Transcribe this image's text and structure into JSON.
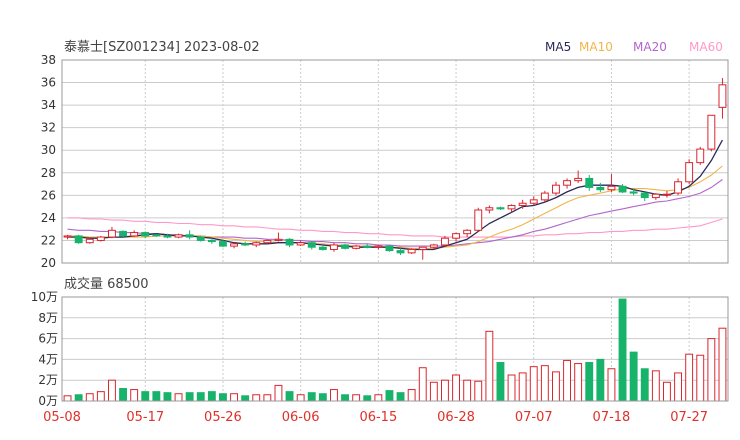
{
  "header": {
    "title": "泰慕士[SZ001234] 2023-08-02"
  },
  "legend": [
    {
      "label": "MA5",
      "color": "#2a2a5a"
    },
    {
      "label": "MA10",
      "color": "#f0b54a"
    },
    {
      "label": "MA20",
      "color": "#b266cc"
    },
    {
      "label": "MA60",
      "color": "#ff99c8"
    }
  ],
  "volume_panel": {
    "title": "成交量 68500"
  },
  "colors": {
    "up": "#d9262e",
    "down": "#18b36b",
    "grid": "#cccccc",
    "frame": "#999999"
  },
  "chart_data": [
    {
      "type": "candlestick",
      "title": "泰慕士[SZ001234] 2023-08-02",
      "ylim": [
        20,
        38
      ],
      "yticks": [
        "20",
        "22",
        "24",
        "26",
        "28",
        "30",
        "32",
        "34",
        "36",
        "38"
      ],
      "grid": true,
      "legend_placement": "top-right",
      "xticks": [
        {
          "label": "05-08",
          "index": 0
        },
        {
          "label": "05-17",
          "index": 7
        },
        {
          "label": "05-26",
          "index": 14
        },
        {
          "label": "06-06",
          "index": 21
        },
        {
          "label": "06-15",
          "index": 28
        },
        {
          "label": "06-28",
          "index": 35
        },
        {
          "label": "07-07",
          "index": 42
        },
        {
          "label": "07-18",
          "index": 49
        },
        {
          "label": "07-27",
          "index": 56
        }
      ],
      "ohlc": [
        [
          22.3,
          22.5,
          22.1,
          22.4
        ],
        [
          22.4,
          22.5,
          21.7,
          21.8
        ],
        [
          21.8,
          22.2,
          21.7,
          22.1
        ],
        [
          22.0,
          22.4,
          21.9,
          22.3
        ],
        [
          22.3,
          23.2,
          22.2,
          22.9
        ],
        [
          22.8,
          22.9,
          22.3,
          22.4
        ],
        [
          22.4,
          22.9,
          22.3,
          22.7
        ],
        [
          22.7,
          22.8,
          22.2,
          22.4
        ],
        [
          22.5,
          22.6,
          22.3,
          22.4
        ],
        [
          22.4,
          22.6,
          22.2,
          22.3
        ],
        [
          22.3,
          22.6,
          22.2,
          22.5
        ],
        [
          22.5,
          22.9,
          22.1,
          22.3
        ],
        [
          22.3,
          22.4,
          21.9,
          22.0
        ],
        [
          22.0,
          22.2,
          21.7,
          21.9
        ],
        [
          21.9,
          22.1,
          21.4,
          21.5
        ],
        [
          21.5,
          21.8,
          21.3,
          21.7
        ],
        [
          21.7,
          21.9,
          21.5,
          21.6
        ],
        [
          21.6,
          21.9,
          21.4,
          21.8
        ],
        [
          21.8,
          22.1,
          21.7,
          22.0
        ],
        [
          22.0,
          22.7,
          21.9,
          22.1
        ],
        [
          22.1,
          22.2,
          21.4,
          21.6
        ],
        [
          21.6,
          22.0,
          21.5,
          21.8
        ],
        [
          21.8,
          21.9,
          21.2,
          21.4
        ],
        [
          21.4,
          21.5,
          21.1,
          21.2
        ],
        [
          21.2,
          21.8,
          21.0,
          21.6
        ],
        [
          21.6,
          21.7,
          21.2,
          21.3
        ],
        [
          21.3,
          21.6,
          21.2,
          21.5
        ],
        [
          21.5,
          21.7,
          21.3,
          21.4
        ],
        [
          21.4,
          21.6,
          21.2,
          21.5
        ],
        [
          21.5,
          21.6,
          21.0,
          21.1
        ],
        [
          21.1,
          21.3,
          20.7,
          20.9
        ],
        [
          20.9,
          21.3,
          20.8,
          21.2
        ],
        [
          21.2,
          21.4,
          20.3,
          21.4
        ],
        [
          21.4,
          21.7,
          21.2,
          21.6
        ],
        [
          21.6,
          22.4,
          21.5,
          22.2
        ],
        [
          22.2,
          22.7,
          21.9,
          22.6
        ],
        [
          22.6,
          23.0,
          22.3,
          22.9
        ],
        [
          22.9,
          24.9,
          22.8,
          24.7
        ],
        [
          24.7,
          25.1,
          24.4,
          24.9
        ],
        [
          24.9,
          25.0,
          24.7,
          24.8
        ],
        [
          24.8,
          25.2,
          24.5,
          25.1
        ],
        [
          25.1,
          25.6,
          24.8,
          25.3
        ],
        [
          25.3,
          25.9,
          25.1,
          25.6
        ],
        [
          25.6,
          26.4,
          25.4,
          26.2
        ],
        [
          26.2,
          27.2,
          26.0,
          26.9
        ],
        [
          26.9,
          27.5,
          26.6,
          27.3
        ],
        [
          27.3,
          28.2,
          27.1,
          27.5
        ],
        [
          27.5,
          27.8,
          26.4,
          26.7
        ],
        [
          26.7,
          27.1,
          26.3,
          26.5
        ],
        [
          26.5,
          27.9,
          26.3,
          26.8
        ],
        [
          26.8,
          27.0,
          26.2,
          26.3
        ],
        [
          26.3,
          26.6,
          26.0,
          26.2
        ],
        [
          26.2,
          26.3,
          25.5,
          25.8
        ],
        [
          25.8,
          26.2,
          25.6,
          26.1
        ],
        [
          26.1,
          26.4,
          25.8,
          26.1
        ],
        [
          26.2,
          27.5,
          26.0,
          27.2
        ],
        [
          27.2,
          29.2,
          27.0,
          28.9
        ],
        [
          28.9,
          30.3,
          28.7,
          30.1
        ],
        [
          30.1,
          33.1,
          29.9,
          33.1
        ],
        [
          33.8,
          36.4,
          32.8,
          35.8
        ]
      ],
      "ma5": [
        22.3,
        22.3,
        22.2,
        22.2,
        22.3,
        22.3,
        22.4,
        22.5,
        22.6,
        22.5,
        22.4,
        22.4,
        22.3,
        22.2,
        22.0,
        21.8,
        21.7,
        21.7,
        21.7,
        21.8,
        21.8,
        21.8,
        21.7,
        21.6,
        21.5,
        21.5,
        21.4,
        21.4,
        21.4,
        21.4,
        21.3,
        21.2,
        21.2,
        21.2,
        21.5,
        21.8,
        22.1,
        22.8,
        23.5,
        24.0,
        24.5,
        25.0,
        25.1,
        25.4,
        25.8,
        26.3,
        26.7,
        26.9,
        26.9,
        26.9,
        26.8,
        26.5,
        26.3,
        26.1,
        26.0,
        26.3,
        26.8,
        27.7,
        29.1,
        30.9
      ],
      "ma10": [
        22.4,
        22.4,
        22.3,
        22.3,
        22.3,
        22.3,
        22.3,
        22.3,
        22.4,
        22.4,
        22.4,
        22.4,
        22.4,
        22.3,
        22.2,
        22.1,
        22.0,
        21.9,
        21.9,
        21.8,
        21.8,
        21.8,
        21.7,
        21.7,
        21.6,
        21.6,
        21.5,
        21.5,
        21.5,
        21.4,
        21.4,
        21.3,
        21.3,
        21.3,
        21.4,
        21.5,
        21.6,
        21.9,
        22.3,
        22.7,
        23.0,
        23.4,
        23.9,
        24.4,
        24.9,
        25.4,
        25.8,
        26.0,
        26.2,
        26.4,
        26.6,
        26.6,
        26.6,
        26.5,
        26.4,
        26.5,
        26.7,
        27.2,
        27.8,
        28.6
      ],
      "ma20": [
        23.0,
        22.9,
        22.9,
        22.8,
        22.8,
        22.7,
        22.7,
        22.6,
        22.6,
        22.5,
        22.5,
        22.4,
        22.4,
        22.3,
        22.3,
        22.3,
        22.2,
        22.2,
        22.1,
        22.1,
        22.0,
        22.0,
        21.9,
        21.9,
        21.8,
        21.8,
        21.7,
        21.7,
        21.6,
        21.6,
        21.5,
        21.5,
        21.5,
        21.5,
        21.5,
        21.6,
        21.7,
        21.8,
        21.9,
        22.1,
        22.3,
        22.5,
        22.8,
        23.0,
        23.3,
        23.6,
        23.9,
        24.2,
        24.4,
        24.6,
        24.8,
        25.0,
        25.2,
        25.4,
        25.5,
        25.7,
        25.9,
        26.2,
        26.7,
        27.4
      ],
      "ma60": [
        24.0,
        24.0,
        23.9,
        23.9,
        23.8,
        23.8,
        23.7,
        23.7,
        23.6,
        23.6,
        23.5,
        23.5,
        23.4,
        23.4,
        23.3,
        23.3,
        23.2,
        23.2,
        23.1,
        23.0,
        23.0,
        22.9,
        22.9,
        22.8,
        22.8,
        22.7,
        22.7,
        22.6,
        22.6,
        22.5,
        22.5,
        22.4,
        22.4,
        22.4,
        22.3,
        22.3,
        22.3,
        22.3,
        22.3,
        22.3,
        22.3,
        22.4,
        22.4,
        22.5,
        22.5,
        22.6,
        22.6,
        22.7,
        22.7,
        22.8,
        22.8,
        22.9,
        22.9,
        23.0,
        23.0,
        23.1,
        23.2,
        23.3,
        23.6,
        23.9
      ]
    },
    {
      "type": "bar",
      "title": "成交量 68500",
      "ylim": [
        0,
        100000
      ],
      "yticks": [
        "0万",
        "2万",
        "4万",
        "6万",
        "8万",
        "10万"
      ],
      "values": [
        5000,
        6000,
        7000,
        9000,
        20000,
        12000,
        11000,
        9000,
        9000,
        8000,
        7000,
        8000,
        8000,
        9000,
        7000,
        7000,
        5000,
        6000,
        6000,
        15000,
        9000,
        6000,
        8000,
        7000,
        11000,
        6000,
        6000,
        5000,
        6000,
        10000,
        8000,
        11000,
        32000,
        18000,
        20000,
        25000,
        20000,
        19000,
        67000,
        37000,
        25000,
        27000,
        33000,
        34000,
        28000,
        39000,
        36000,
        37000,
        40000,
        31000,
        98000,
        47000,
        31000,
        29000,
        18000,
        27000,
        45000,
        44000,
        60000,
        70000
      ]
    }
  ]
}
